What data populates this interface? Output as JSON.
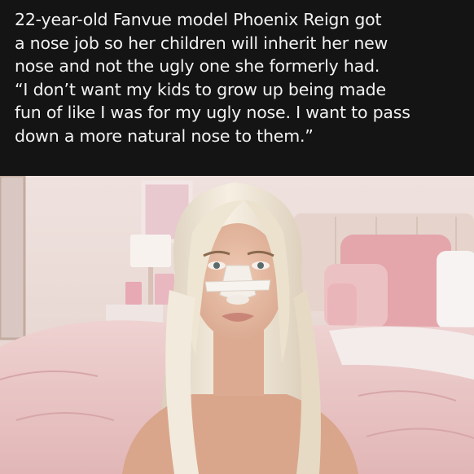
{
  "caption": {
    "lines": [
      "22-year-old Fanvue model Phoenix Reign got",
      "a nose job so her children will inherit her new",
      "nose and not the ugly one she formerly had.",
      "“I don’t want my kids to grow up being made",
      "fun of like I was for my ugly nose. I want to pass",
      "down a more natural nose to them.”"
    ]
  },
  "photo": {
    "subject": "woman-with-nose-bandage",
    "setting": "pink-bedroom",
    "colors": {
      "wall": "#eadbd7",
      "headboard": "#e7d6cf",
      "bedding": "#e9c7c6",
      "pillow_pink": "#e6a9ad",
      "hair": "#efe6d6",
      "skin": "#e7bba3",
      "bandage": "#f4efe9"
    }
  }
}
